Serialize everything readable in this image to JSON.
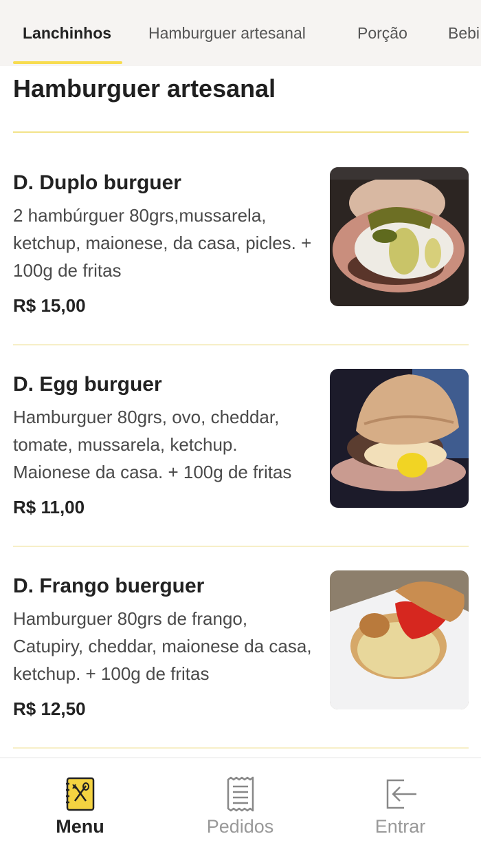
{
  "tabs": [
    {
      "label": "Lanchinhos",
      "active": true
    },
    {
      "label": "Hamburguer artesanal",
      "active": false
    },
    {
      "label": "Porção",
      "active": false
    },
    {
      "label": "Bebi",
      "active": false
    }
  ],
  "section": {
    "title": "Hamburguer artesanal"
  },
  "products": [
    {
      "name": "D. Duplo burguer",
      "description": "2 hambúrguer 80grs,mussarela, ketchup, maionese, da casa, picles. + 100g de fritas",
      "price": "R$ 15,00"
    },
    {
      "name": "D. Egg burguer",
      "description": "Hamburguer 80grs, ovo, cheddar, tomate, mussarela, ketchup. Maionese da casa. + 100g de fritas",
      "price": "R$ 11,00"
    },
    {
      "name": "D. Frango buerguer",
      "description": "Hamburguer 80grs de frango, Catupiry, cheddar, maionese da casa, ketchup. + 100g de fritas",
      "price": "R$ 12,50"
    }
  ],
  "bottom_nav": [
    {
      "label": "Menu",
      "icon": "menu-book-icon",
      "active": true
    },
    {
      "label": "Pedidos",
      "icon": "receipt-icon",
      "active": false
    },
    {
      "label": "Entrar",
      "icon": "login-icon",
      "active": false
    }
  ],
  "colors": {
    "accent": "#f7dc4f",
    "tab_bar_bg": "#f6f4f2",
    "inactive_text": "#999999"
  }
}
